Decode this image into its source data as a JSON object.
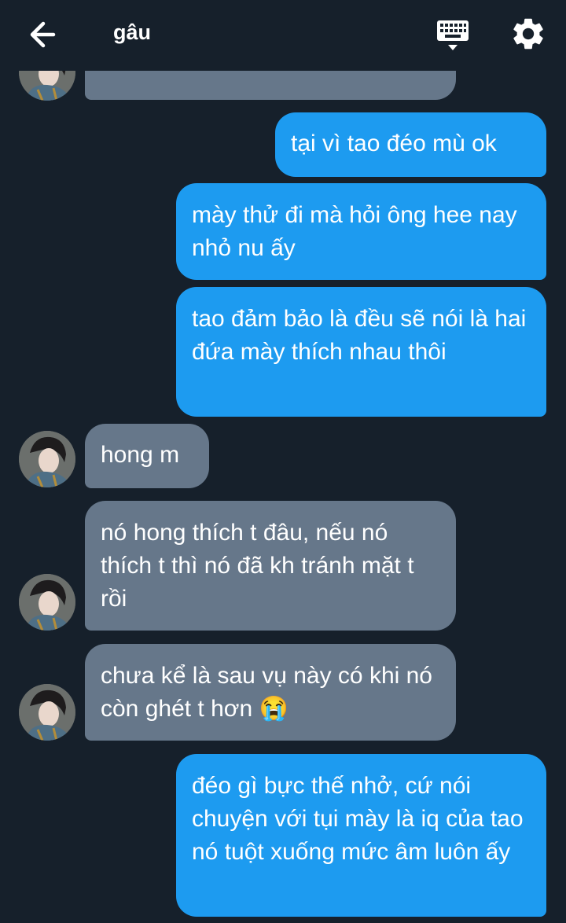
{
  "header": {
    "title": "gâu",
    "back_icon": "arrow-left-icon",
    "keyboard_icon": "keyboard-icon",
    "settings_icon": "gear-icon"
  },
  "colors": {
    "background": "#16202b",
    "outgoing_bubble": "#1d9bf0",
    "incoming_bubble": "#66778a"
  },
  "messages": [
    {
      "direction": "incoming",
      "text": ""
    },
    {
      "direction": "outgoing",
      "text": "tại vì tao đéo mù ok"
    },
    {
      "direction": "outgoing",
      "text": "mày thử đi mà hỏi ông hee nay nhỏ nu ấy"
    },
    {
      "direction": "outgoing",
      "text": "tao đảm bảo là đều sẽ nói là hai đứa mày thích nhau thôi"
    },
    {
      "direction": "incoming",
      "text": "hong m"
    },
    {
      "direction": "incoming",
      "text": "nó hong thích t đâu, nếu nó thích t thì nó đã kh tránh mặt t rồi"
    },
    {
      "direction": "incoming",
      "text": "chưa kể là sau vụ này có khi nó còn ghét t hơn",
      "emoji": "😭"
    },
    {
      "direction": "outgoing",
      "text": "đéo gì bực thế nhở, cứ nói chuyện với tụi mày là iq của tao nó tuột xuống mức âm luôn ấy"
    }
  ]
}
